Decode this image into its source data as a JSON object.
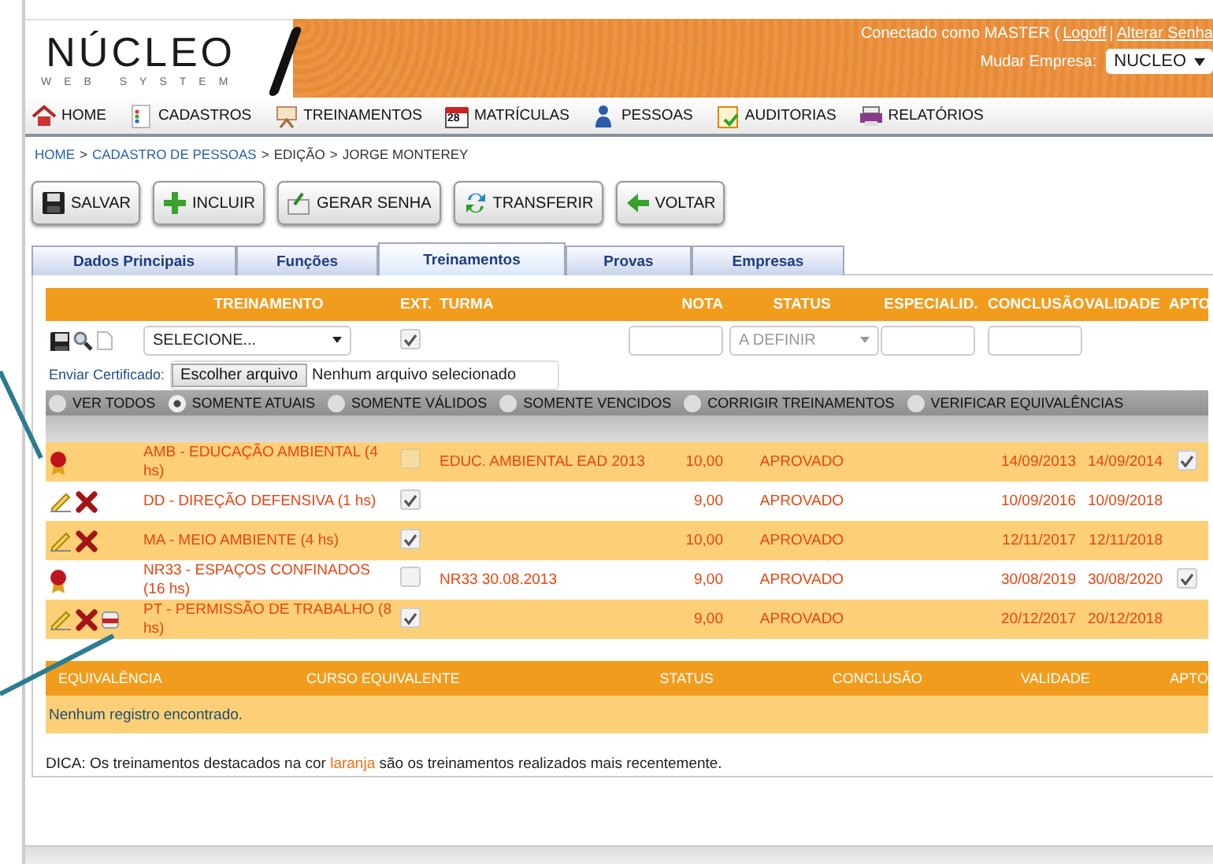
{
  "header": {
    "logo": "NÚCLEO",
    "logo_tagline": "WEB SYSTEM",
    "user_text": "Conectado como MASTER (",
    "logoff_link": "Logoff",
    "separator": "|",
    "password_link": "Alterar Senha",
    "company_label": "Mudar Empresa:",
    "company": "NUCLEO"
  },
  "nav": [
    {
      "label": "HOME",
      "kind": "home"
    },
    {
      "label": "CADASTROS",
      "kind": "list"
    },
    {
      "label": "TREINAMENTOS",
      "kind": "easel"
    },
    {
      "label": "MATRÍCULAS",
      "kind": "calendar",
      "badge": "28"
    },
    {
      "label": "PESSOAS",
      "kind": "person"
    },
    {
      "label": "AUDITORIAS",
      "kind": "clipboard"
    },
    {
      "label": "RELATÓRIOS",
      "kind": "printer"
    }
  ],
  "breadcrumb": [
    {
      "label": "HOME",
      "link": true
    },
    {
      "label": ">",
      "link": false
    },
    {
      "label": "CADASTRO DE PESSOAS",
      "link": true
    },
    {
      "label": ">",
      "link": false
    },
    {
      "label": "EDIÇÃO",
      "link": false
    },
    {
      "label": ">",
      "link": false
    },
    {
      "label": "JORGE MONTEREY",
      "link": false
    }
  ],
  "buttons": [
    {
      "label": "SALVAR",
      "kind": "save"
    },
    {
      "label": "INCLUIR",
      "kind": "add"
    },
    {
      "label": "GERAR SENHA",
      "kind": "key"
    },
    {
      "label": "TRANSFERIR",
      "kind": "transfer"
    },
    {
      "label": "VOLTAR",
      "kind": "back"
    }
  ],
  "tabs": [
    {
      "label": "Dados Principais",
      "selected": false
    },
    {
      "label": "Funções",
      "selected": false
    },
    {
      "label": "Treinamentos",
      "selected": true
    },
    {
      "label": "Provas",
      "selected": false
    },
    {
      "label": "Empresas",
      "selected": false
    }
  ],
  "trainings": {
    "columns": [
      "TREINAMENTO",
      "EXT.",
      "TURMA",
      "NOTA",
      "STATUS",
      "ESPECIALID.",
      "CONCLUSÃO",
      "VALIDADE",
      "APTO"
    ],
    "form": {
      "training_select": "SELECIONE...",
      "ext_checked": true,
      "status_select": "A DEFINIR"
    },
    "certificate": {
      "label": "Enviar Certificado:",
      "button": "Escolher arquivo",
      "file_status": "Nenhum arquivo selecionado"
    },
    "filters": [
      {
        "label": "VER TODOS",
        "selected": false
      },
      {
        "label": "SOMENTE ATUAIS",
        "selected": true
      },
      {
        "label": "SOMENTE VÁLIDOS",
        "selected": false
      },
      {
        "label": "SOMENTE VENCIDOS",
        "selected": false
      },
      {
        "label": "CORRIGIR TREINAMENTOS",
        "selected": false
      },
      {
        "label": "VERIFICAR EQUIVALÊNCIAS",
        "selected": false
      }
    ],
    "rows": [
      {
        "kind": "certified",
        "pdf": false,
        "training": "AMB - EDUCAÇÃO AMBIENTAL (4 hs)",
        "ext": false,
        "class": "EDUC. AMBIENTAL EAD 2013",
        "grade": "10,00",
        "status": "APROVADO",
        "completion": "14/09/2013",
        "validity": "14/09/2014",
        "apto": true,
        "highlighted": true
      },
      {
        "kind": "editable",
        "pdf": false,
        "training": "DD - DIREÇÃO DEFENSIVA (1 hs)",
        "ext": true,
        "class": "",
        "grade": "9,00",
        "status": "APROVADO",
        "completion": "10/09/2016",
        "validity": "10/09/2018",
        "apto": false,
        "highlighted": false
      },
      {
        "kind": "editable",
        "pdf": false,
        "training": "MA - MEIO AMBIENTE (4 hs)",
        "ext": true,
        "class": "",
        "grade": "10,00",
        "status": "APROVADO",
        "completion": "12/11/2017",
        "validity": "12/11/2018",
        "apto": false,
        "highlighted": true
      },
      {
        "kind": "certified",
        "pdf": false,
        "training": "NR33 - ESPAÇOS CONFINADOS (16 hs)",
        "ext": false,
        "class": "NR33 30.08.2013",
        "grade": "9,00",
        "status": "APROVADO",
        "completion": "30/08/2019",
        "validity": "30/08/2020",
        "apto": true,
        "highlighted": false
      },
      {
        "kind": "editable",
        "pdf": true,
        "training": "PT - PERMISSÃO DE TRABALHO (8 hs)",
        "ext": true,
        "class": "",
        "grade": "9,00",
        "status": "APROVADO",
        "completion": "20/12/2017",
        "validity": "20/12/2018",
        "apto": false,
        "highlighted": true
      }
    ]
  },
  "equivalences": {
    "columns": [
      "EQUIVALÊNCIA",
      "CURSO EQUIVALENTE",
      "STATUS",
      "CONCLUSÃO",
      "VALIDADE",
      "APTO"
    ],
    "empty": "Nenhum registro encontrado."
  },
  "tip": "DICA: Os treinamentos destacados na cor **laranja** são os treinamentos realizados mais recentemente."
}
